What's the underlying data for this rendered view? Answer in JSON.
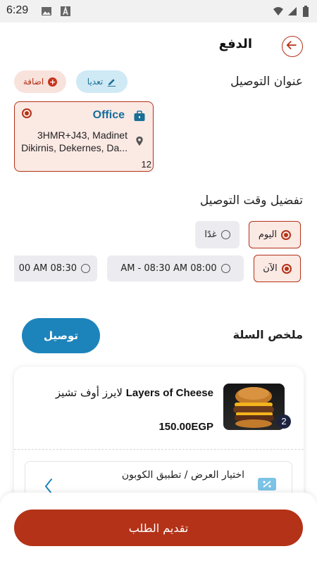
{
  "status_bar": {
    "time": "6:29"
  },
  "header": {
    "title": "الدفع"
  },
  "delivery_address": {
    "title": "عنوان التوصيل",
    "edit_label": "تعديا",
    "add_label": "اضافة",
    "selected": {
      "name": "Office",
      "line1": "3HMR+J43, Madinet",
      "line2": "Dikirnis, Dekernes, Da...",
      "number": "12"
    }
  },
  "delivery_time": {
    "title": "تفضيل وقت التوصيل",
    "days": [
      {
        "label": "اليوم",
        "selected": true
      },
      {
        "label": "غدًا",
        "selected": false
      }
    ],
    "slots": [
      {
        "label": "الآن",
        "selected": true
      },
      {
        "label": "AM - 08:30 AM 08:00",
        "selected": false
      },
      {
        "label": "00 AM 08:30",
        "selected": false
      }
    ]
  },
  "cart": {
    "title": "ملخص السلة",
    "delivery_button": "توصيل",
    "item": {
      "name_ar": "لايرز أوف تشيز",
      "name_en": "Layers of Cheese",
      "price": "150.00EGP",
      "quantity": "2"
    },
    "coupon_label": "اختيار العرض / تطبيق الكوبون"
  },
  "footer": {
    "submit_label": "تقديم الطلب"
  },
  "colors": {
    "primary": "#b43218",
    "accent_blue": "#1d84bb",
    "selected_bg": "#fbe9e4"
  },
  "icons": [
    "image-icon",
    "a-icon",
    "wifi-icon",
    "signal-icon",
    "battery-icon",
    "back-arrow-icon",
    "pencil-icon",
    "plus-icon",
    "briefcase-icon",
    "location-pin-icon",
    "chevron-left-icon",
    "coupon-icon"
  ]
}
